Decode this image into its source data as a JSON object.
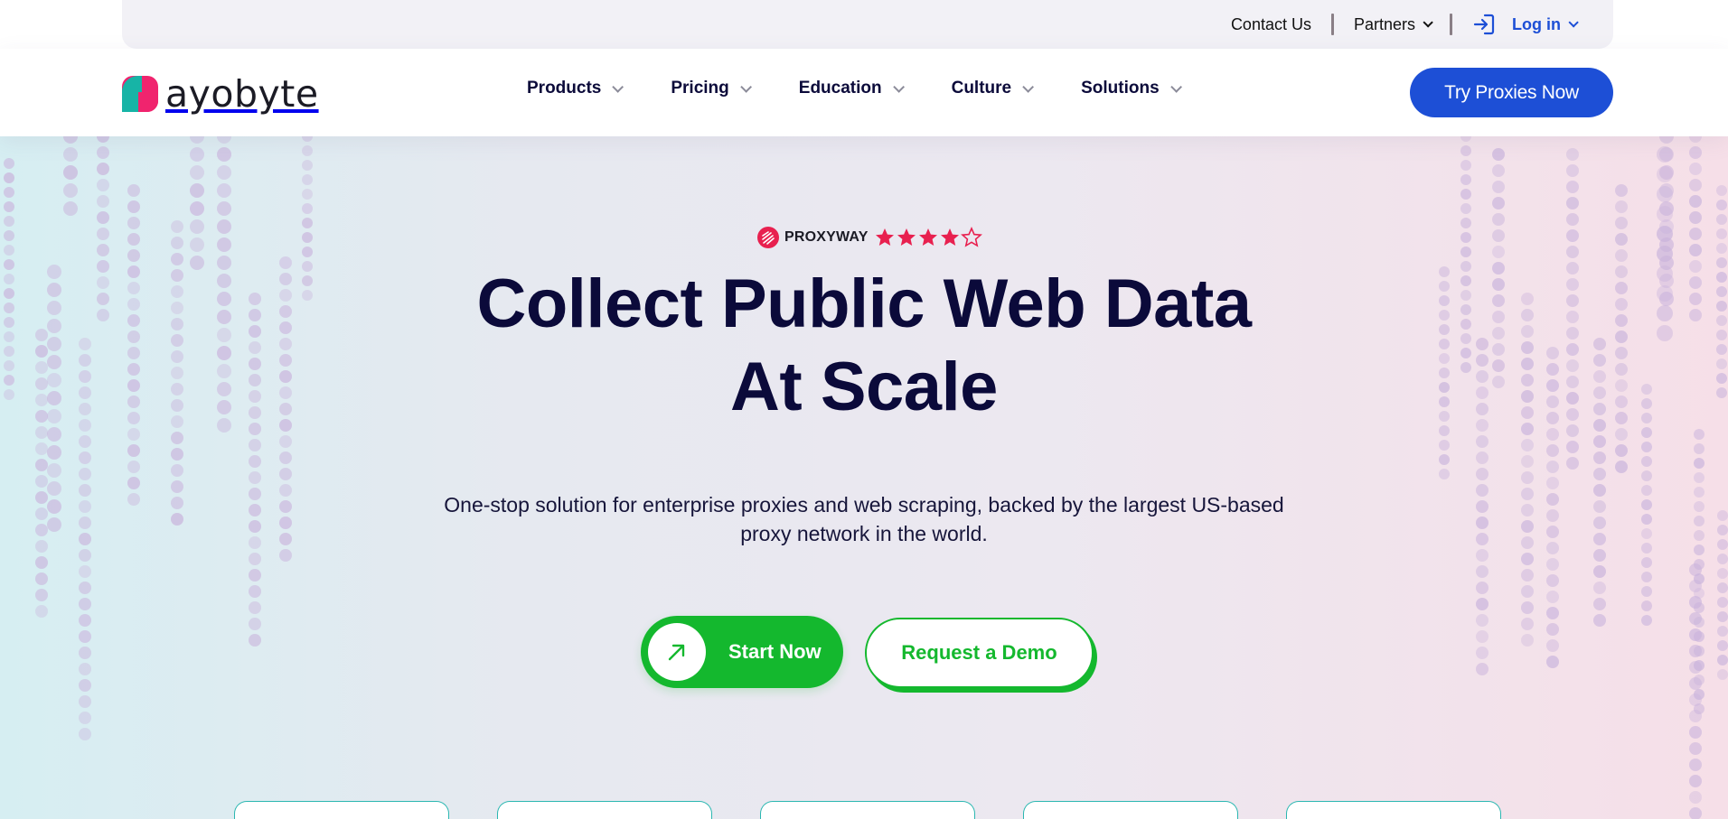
{
  "topbar": {
    "contact_label": "Contact Us",
    "partners_label": "Partners",
    "login_label": "Log in"
  },
  "header": {
    "logo_text": "ayobyte",
    "nav": [
      {
        "label": "Products"
      },
      {
        "label": "Pricing"
      },
      {
        "label": "Education"
      },
      {
        "label": "Culture"
      },
      {
        "label": "Solutions"
      }
    ],
    "cta_label": "Try Proxies Now"
  },
  "hero": {
    "rating_brand": "PROXYWAY",
    "rating_stars": 4,
    "rating_max": 5,
    "headline_line1": "Collect Public Web Data",
    "headline_line2": "At Scale",
    "subtext_line1": "One-stop solution for enterprise proxies and web scraping, backed by the largest US-based",
    "subtext_line2": "proxy network in the world.",
    "start_label": "Start Now",
    "demo_label": "Request a Demo"
  },
  "colors": {
    "brand_blue": "#1d4fd6",
    "brand_green": "#14b82e",
    "heading_navy": "#0b0a3a",
    "logo_pink": "#f0246e",
    "logo_teal": "#17b4a6",
    "star_red": "#e8204f"
  },
  "icons": [
    "login-icon",
    "chevron-down-icon",
    "arrow-up-right-icon",
    "star-icon",
    "proxyway-logo"
  ]
}
